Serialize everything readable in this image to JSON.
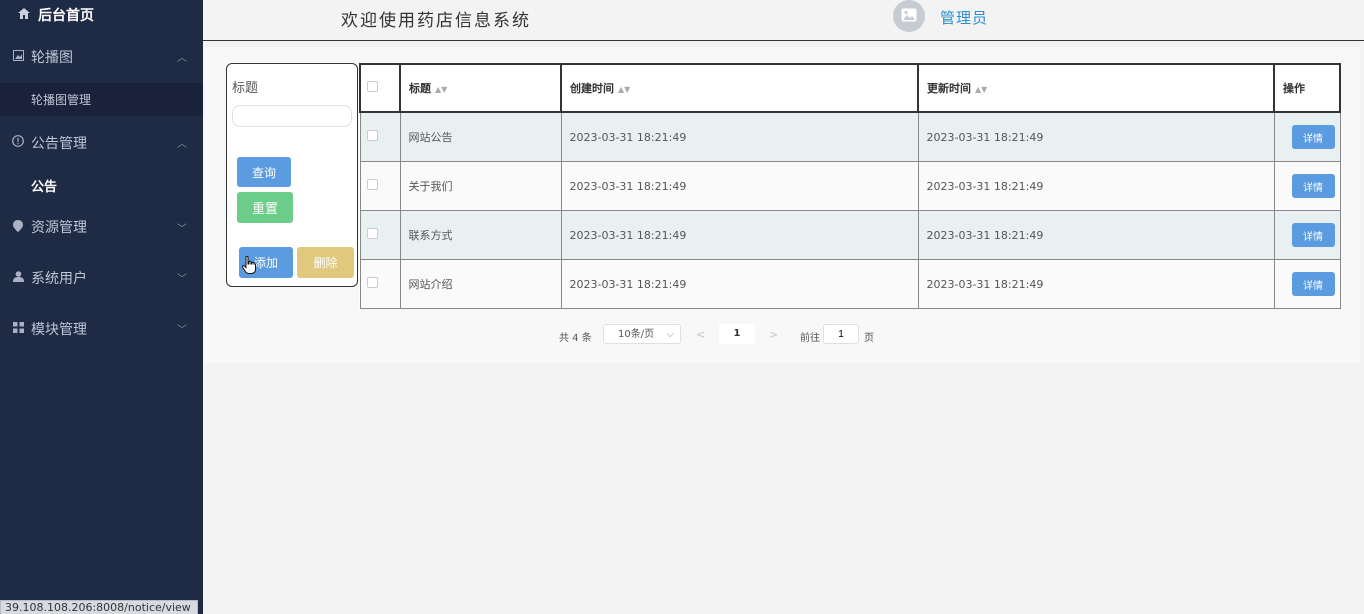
{
  "sidebar": {
    "home": "后台首页",
    "groups": [
      {
        "label": "轮播图",
        "icon": "image-icon",
        "sub": [
          {
            "label": "轮播图管理"
          }
        ]
      },
      {
        "label": "公告管理",
        "icon": "info-icon",
        "sub": [
          {
            "label": "公告"
          }
        ]
      },
      {
        "label": "资源管理",
        "icon": "location-icon"
      },
      {
        "label": "系统用户",
        "icon": "user-icon"
      },
      {
        "label": "模块管理",
        "icon": "grid-icon"
      }
    ]
  },
  "header": {
    "welcome": "欢迎使用药店信息系统",
    "user": "管理员"
  },
  "search": {
    "label": "标题",
    "placeholder": "",
    "query": "查询",
    "reset": "重置",
    "add": "添加",
    "delete": "删除"
  },
  "table": {
    "headers": [
      "标题",
      "创建时间",
      "更新时间",
      "操作"
    ],
    "rows": [
      {
        "title": "网站公告",
        "created": "2023-03-31 18:21:49",
        "updated": "2023-03-31 18:21:49",
        "action": "详情"
      },
      {
        "title": "关于我们",
        "created": "2023-03-31 18:21:49",
        "updated": "2023-03-31 18:21:49",
        "action": "详情"
      },
      {
        "title": "联系方式",
        "created": "2023-03-31 18:21:49",
        "updated": "2023-03-31 18:21:49",
        "action": "详情"
      },
      {
        "title": "网站介绍",
        "created": "2023-03-31 18:21:49",
        "updated": "2023-03-31 18:21:49",
        "action": "详情"
      }
    ]
  },
  "pagination": {
    "total": "共 4 条",
    "page_size": "10条/页",
    "current": "1",
    "goto_label": "前往",
    "goto_value": "1",
    "goto_unit": "页"
  },
  "status_url": "39.108.108.206:8008/notice/view"
}
